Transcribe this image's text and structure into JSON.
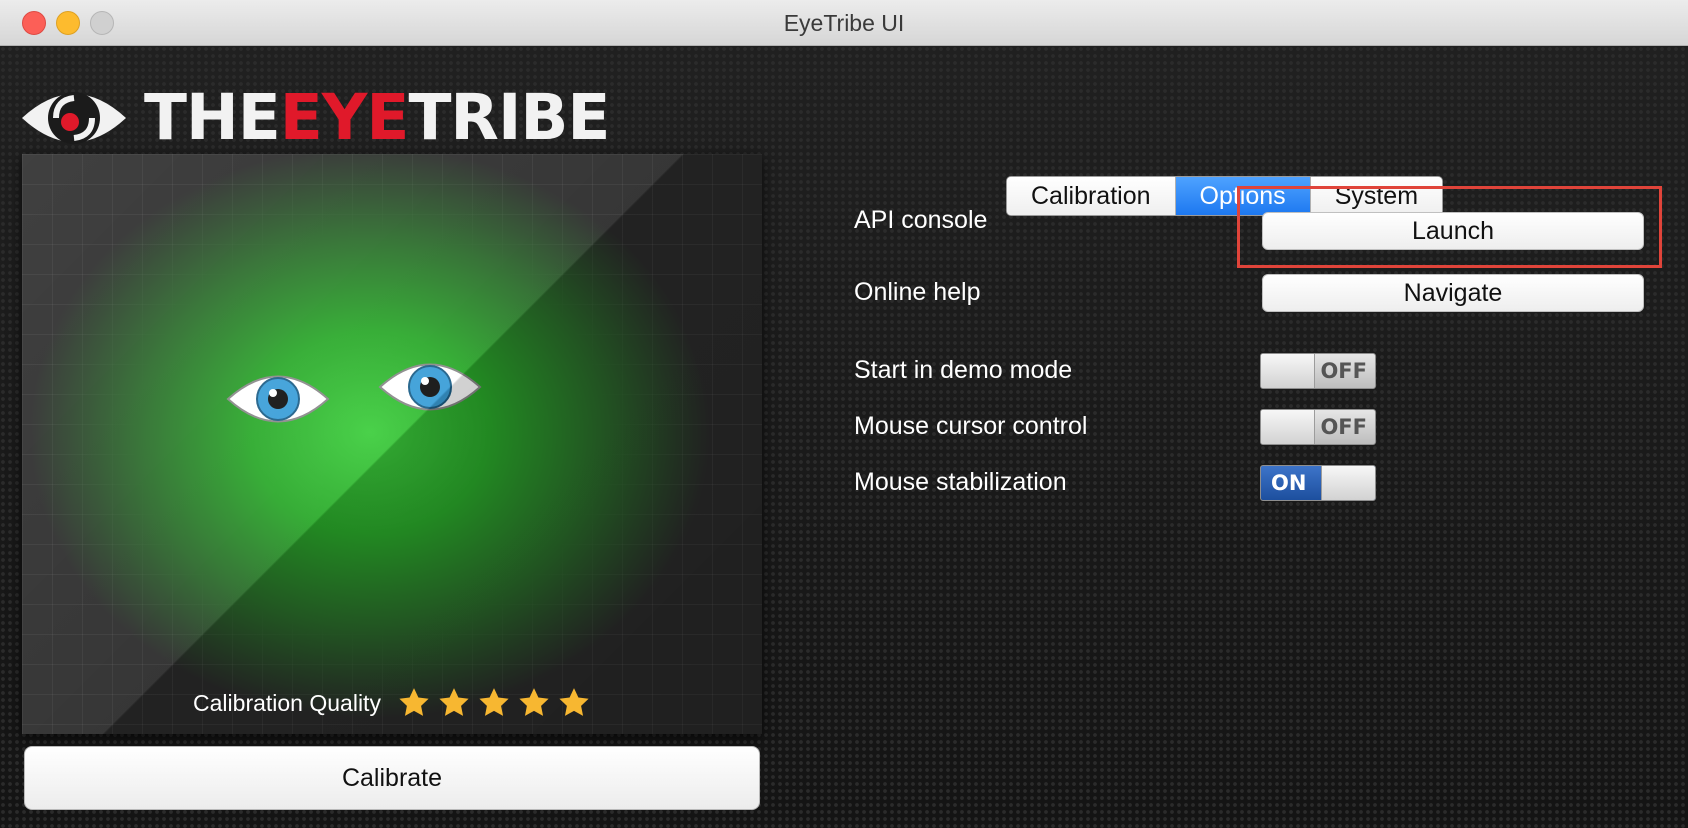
{
  "window": {
    "title": "EyeTribe UI"
  },
  "logo": {
    "part1": "THE",
    "part2": "EYE",
    "part3": "TRIBE"
  },
  "preview": {
    "quality_label": "Calibration Quality",
    "stars": 5,
    "stars_max": 5
  },
  "calibrate": {
    "label": "Calibrate"
  },
  "tabs": [
    {
      "label": "Calibration",
      "active": false
    },
    {
      "label": "Options",
      "active": true
    },
    {
      "label": "System",
      "active": false
    }
  ],
  "options": {
    "api_console": {
      "label": "API console",
      "button": "Launch"
    },
    "online_help": {
      "label": "Online help",
      "button": "Navigate"
    },
    "demo_mode": {
      "label": "Start in demo mode",
      "state": "OFF"
    },
    "cursor_control": {
      "label": "Mouse cursor control",
      "state": "OFF"
    },
    "stabilization": {
      "label": "Mouse stabilization",
      "state": "ON"
    }
  },
  "colors": {
    "accent": "#1d78f0",
    "brand_red": "#e0192a",
    "highlight": "#e0443a",
    "star": "#f7b731",
    "glow": "#3ece3e"
  }
}
